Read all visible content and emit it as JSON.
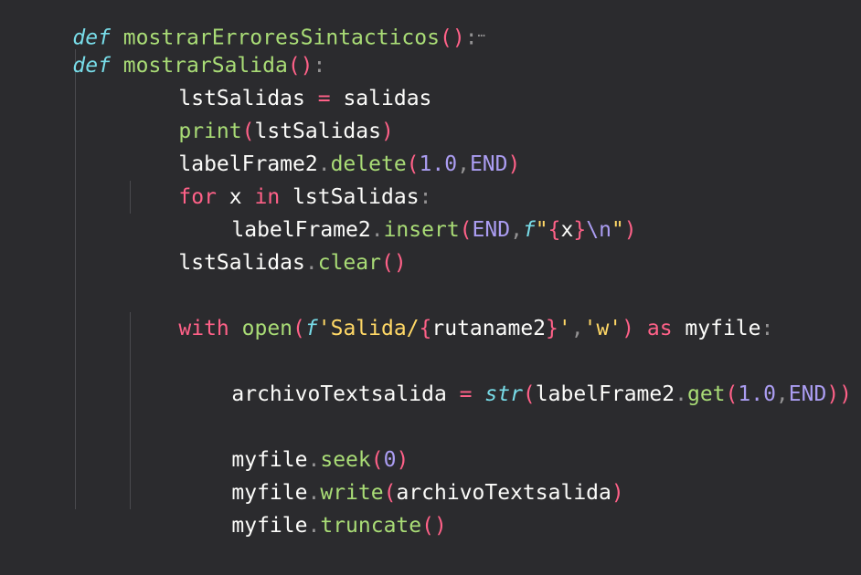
{
  "editor": {
    "top_partial": {
      "kw": "def",
      "name": "mostrarErroresSintacticos",
      "fold": "…"
    },
    "lines": {
      "l1": {
        "kw": "def",
        "fn": "mostrarSalida"
      },
      "l2": {
        "a": "lstSalidas",
        "op": "=",
        "b": "salidas"
      },
      "l3": {
        "fn": "print",
        "arg": "lstSalidas"
      },
      "l4": {
        "obj": "labelFrame2",
        "method": "delete",
        "n": "1.0",
        "c": "END"
      },
      "l5": {
        "kw1": "for",
        "v": "x",
        "kw2": "in",
        "it": "lstSalidas"
      },
      "l6": {
        "obj": "labelFrame2",
        "method": "insert",
        "c": "END",
        "f": "f",
        "q1": "\"",
        "var": "x",
        "esc": "\\n",
        "q2": "\""
      },
      "l7": {
        "obj": "lstSalidas",
        "method": "clear"
      },
      "l9": {
        "kw": "with",
        "fn": "open",
        "f": "f",
        "s1": "'Salida/",
        "var": "rutaname2",
        "s2": "'",
        "mode": "'w'",
        "kw2": "as",
        "name": "myfile"
      },
      "l11": {
        "a": "archivoTextsalida",
        "op": "=",
        "builtin": "str",
        "obj": "labelFrame2",
        "method": "get",
        "n": "1.0",
        "c": "END"
      },
      "l13": {
        "obj": "myfile",
        "method": "seek",
        "n": "0"
      },
      "l14": {
        "obj": "myfile",
        "method": "write",
        "arg": "archivoTextsalida"
      },
      "l15": {
        "obj": "myfile",
        "method": "truncate"
      }
    }
  }
}
